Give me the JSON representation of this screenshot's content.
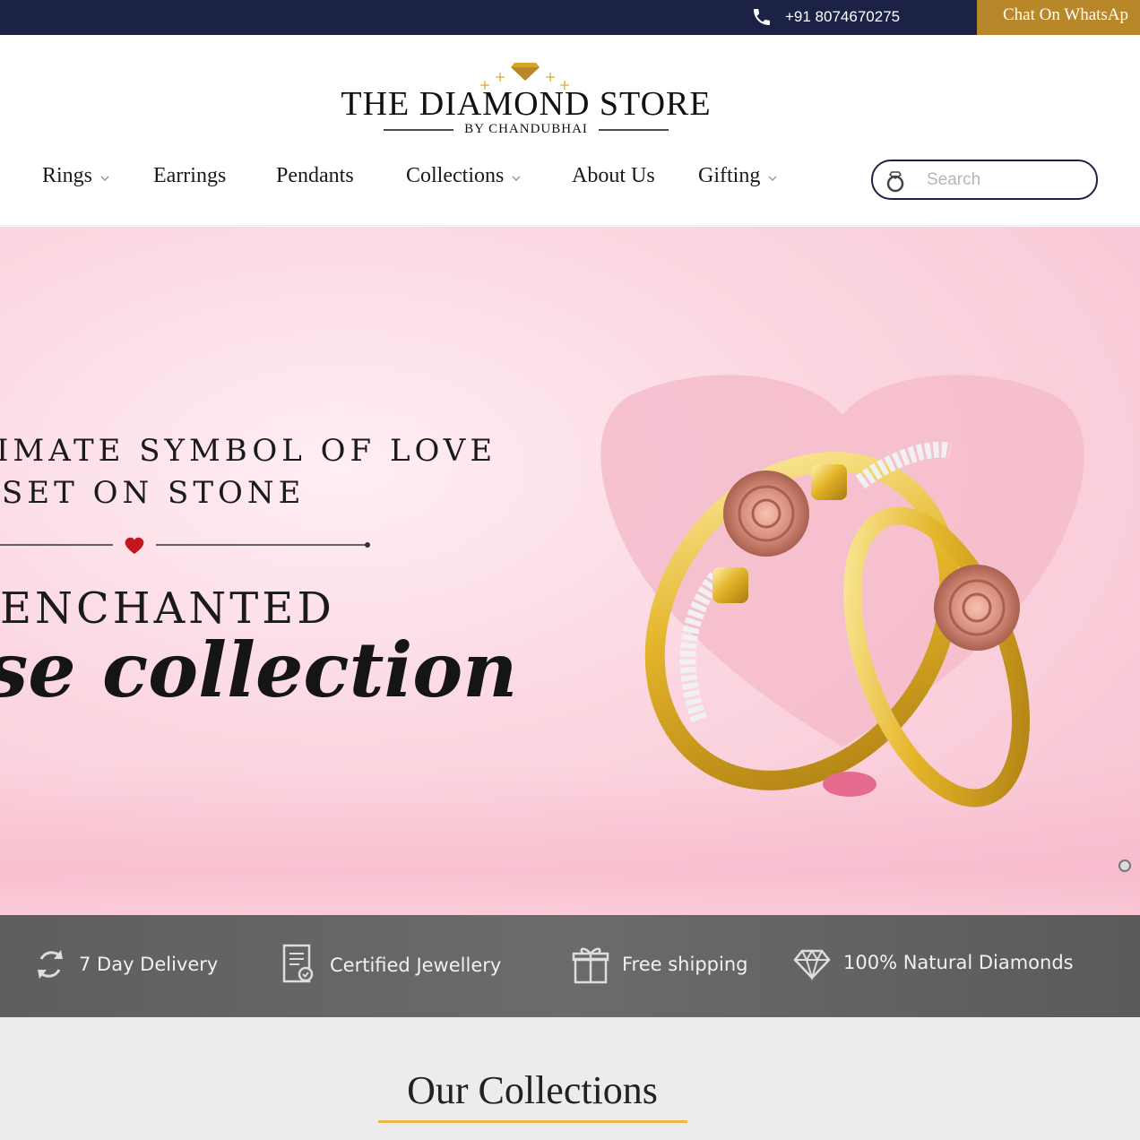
{
  "topbar": {
    "phone": "+91 8074670275",
    "phone_icon": "phone-icon",
    "whatsapp_label": "Chat On WhatsAp",
    "colors": {
      "bar": "#1b2245",
      "whatsapp": "#b8872a"
    }
  },
  "logo": {
    "title": "THE DIAMOND STORE",
    "subtitle": "BY CHANDUBHAI",
    "icon": "diamond-icon"
  },
  "nav": {
    "items": [
      {
        "label": "Rings",
        "dropdown": true
      },
      {
        "label": "Earrings",
        "dropdown": false
      },
      {
        "label": "Pendants",
        "dropdown": false
      },
      {
        "label": "Collections",
        "dropdown": true
      },
      {
        "label": "About Us",
        "dropdown": false
      },
      {
        "label": "Gifting",
        "dropdown": true
      }
    ]
  },
  "search": {
    "placeholder": "Search",
    "value": "",
    "icon": "ring-search-icon"
  },
  "hero": {
    "line1": "IMATE SYMBOL OF LOVE",
    "line2": "SET ON STONE",
    "line3": "ENCHANTED",
    "line4": "se collection",
    "divider_icon": "heart-icon"
  },
  "features": [
    {
      "label": "7 Day Delivery",
      "icon": "refresh-icon"
    },
    {
      "label": "Certified Jewellery",
      "icon": "certificate-icon"
    },
    {
      "label": "Free shipping",
      "icon": "gift-icon"
    },
    {
      "label": "100% Natural Diamonds",
      "icon": "diamond-icon"
    }
  ],
  "collections": {
    "title": "Our Collections",
    "accent": "#f0b64a"
  }
}
